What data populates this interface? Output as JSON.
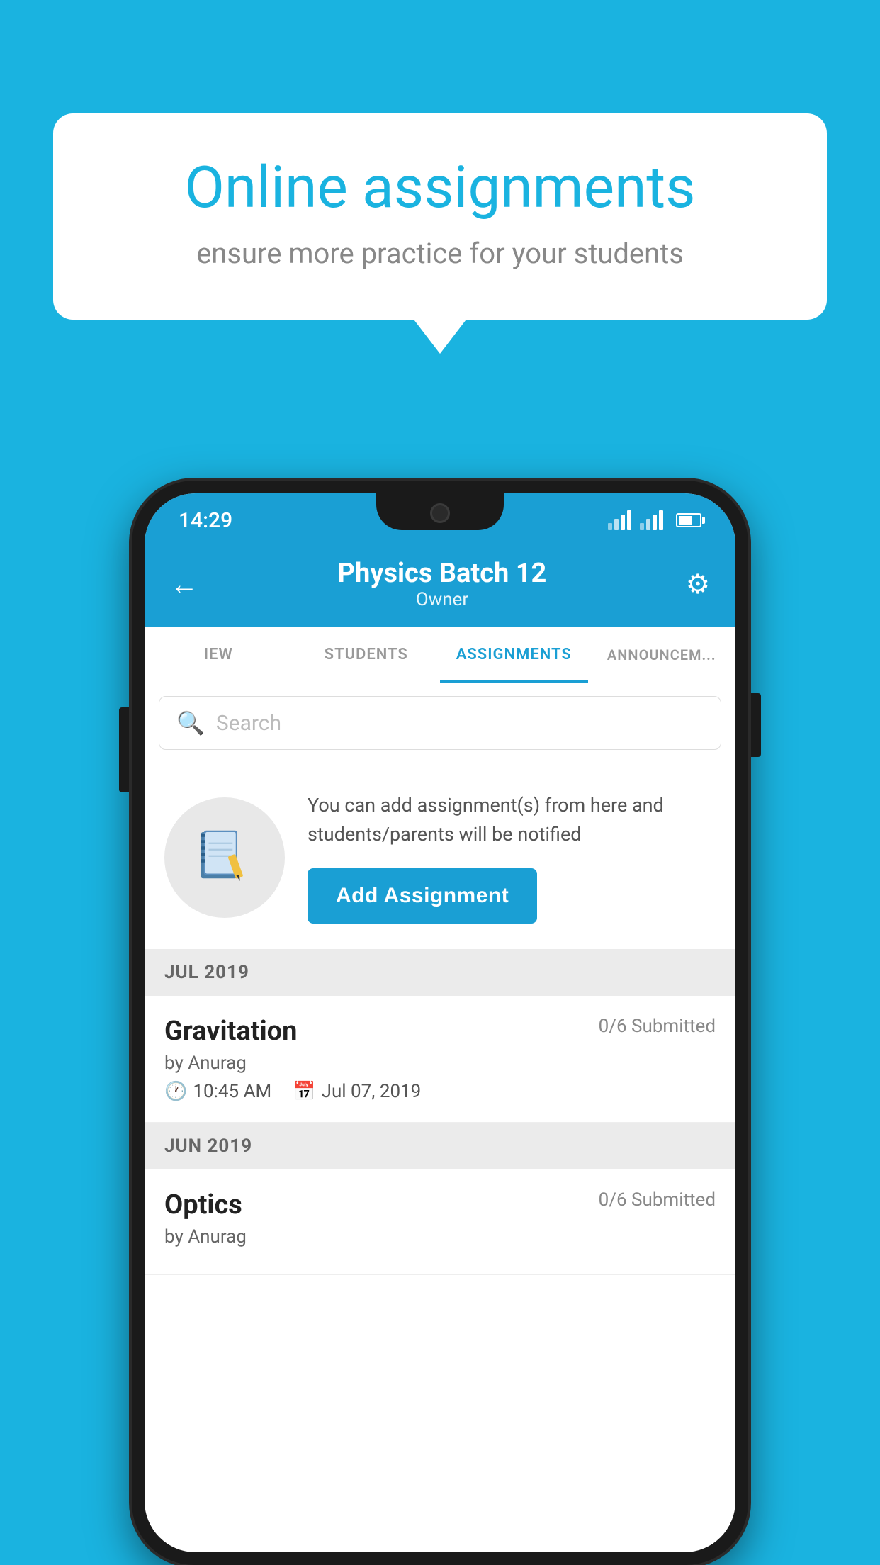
{
  "background_color": "#1ab3e0",
  "tooltip": {
    "title": "Online assignments",
    "subtitle": "ensure more practice for your students"
  },
  "phone": {
    "status_bar": {
      "time": "14:29"
    },
    "header": {
      "title": "Physics Batch 12",
      "subtitle": "Owner",
      "back_label": "←",
      "settings_label": "⚙"
    },
    "tabs": [
      {
        "label": "IEW",
        "active": false
      },
      {
        "label": "STUDENTS",
        "active": false
      },
      {
        "label": "ASSIGNMENTS",
        "active": true
      },
      {
        "label": "ANNOUNCEM...",
        "active": false
      }
    ],
    "search": {
      "placeholder": "Search"
    },
    "promo": {
      "text": "You can add assignment(s) from here and students/parents will be notified",
      "button_label": "Add Assignment"
    },
    "sections": [
      {
        "month": "JUL 2019",
        "assignments": [
          {
            "name": "Gravitation",
            "submitted": "0/6 Submitted",
            "by": "by Anurag",
            "time": "10:45 AM",
            "date": "Jul 07, 2019"
          }
        ]
      },
      {
        "month": "JUN 2019",
        "assignments": [
          {
            "name": "Optics",
            "submitted": "0/6 Submitted",
            "by": "by Anurag",
            "time": "",
            "date": ""
          }
        ]
      }
    ]
  }
}
